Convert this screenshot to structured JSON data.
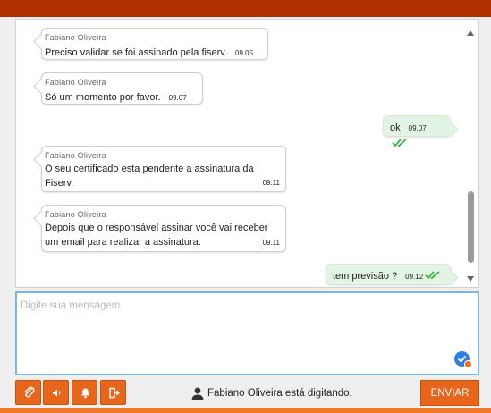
{
  "messages": [
    {
      "direction": "in",
      "sender": "Fabiano Oliveira",
      "text": "Preciso validar se foi assinado pela fiserv.",
      "time": "09.05"
    },
    {
      "direction": "in",
      "sender": "Fabiano Oliveira",
      "text": "Só um momento por favor.",
      "time": "09.07"
    },
    {
      "direction": "out",
      "text": "ok",
      "time": "09.07",
      "status_icon": "double-check-icon"
    },
    {
      "direction": "in",
      "sender": "Fabiano Oliveira",
      "text": "O seu certificado esta pendente a assinatura da Fiserv.",
      "time": "09.11"
    },
    {
      "direction": "in",
      "sender": "Fabiano Oliveira",
      "text": "Depois que o responsável assinar você vai receber um email para realizar a assinatura.",
      "time": "09.11"
    },
    {
      "direction": "out",
      "text": "tem previsão ?",
      "time": "09.12",
      "status_icon": "double-check-icon"
    }
  ],
  "composer": {
    "placeholder": "Digite sua mensagem",
    "value": ""
  },
  "toolbar": {
    "buttons": [
      {
        "name": "attach",
        "icon": "paperclip-icon"
      },
      {
        "name": "sound",
        "icon": "speaker-icon"
      },
      {
        "name": "notifications",
        "icon": "bell-icon"
      },
      {
        "name": "logout",
        "icon": "exit-icon"
      }
    ],
    "typing_status": "Fabiano Oliveira está digitando.",
    "send_label": "ENVIAR"
  },
  "colors": {
    "accent": "#e8661c",
    "header": "#b03000",
    "outgoing_bubble": "#e4f4e4",
    "read_check": "#3cb043",
    "input_border": "#7ab8e0"
  }
}
